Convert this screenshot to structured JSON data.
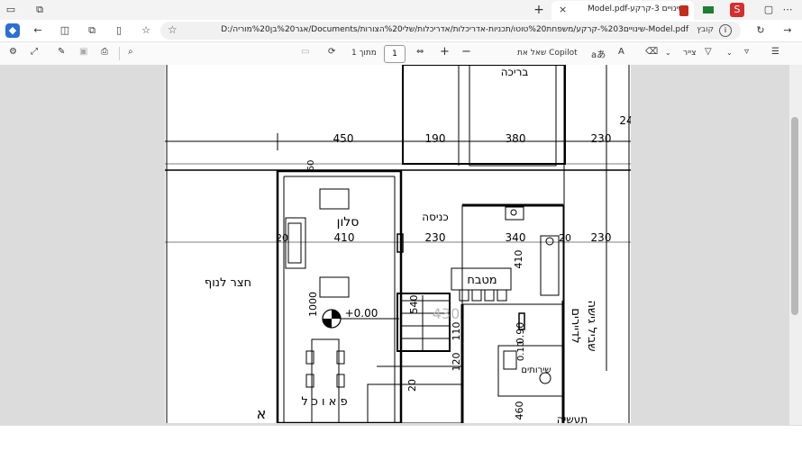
{
  "tab": {
    "title": "Model.pdf-שינויים 3-קרקע",
    "close": "×"
  },
  "window": {
    "new_tab": "+"
  },
  "address": {
    "url": "D:/אגר%20בן%20מוריה/Documents/שינויים%203-קרקע/משפחת%20טוטו/תכניות-אדריכלות/אדריכלות/שלי%20הצורות-Model.pdf",
    "label": "קובץ"
  },
  "pdf_toolbar": {
    "page_label": "מתוך 1",
    "page_value": "1",
    "copilot": "שאל את Copilot",
    "draw": "צייר",
    "read_aloud": "aあ"
  },
  "plan": {
    "rooms": {
      "pool": "בריכה",
      "salon": "סלון",
      "entrance": "כניסה",
      "kitchen": "מטבח",
      "yard": "חצר לנוף",
      "path": "שביל גישה",
      "path2": "לדיירים",
      "toilet": "שירותים",
      "dining": "פ א ו כ ל",
      "other": "תעשיה",
      "alef": "א"
    },
    "dims": {
      "d450": "450",
      "d190": "190",
      "d380": "380",
      "d230a": "230",
      "d24": "24",
      "d20a": "20",
      "d410": "410",
      "d230b": "230",
      "d340": "340",
      "d20b": "20",
      "d230c": "230",
      "d410v": "410",
      "d1000": "1000",
      "d540": "540",
      "d110": "110",
      "d120": "120",
      "d090": "0.90",
      "d010": "0.10",
      "d460": "460",
      "d20c": "20",
      "d60": "60",
      "elev": "+0.00",
      "d430": "430"
    }
  }
}
